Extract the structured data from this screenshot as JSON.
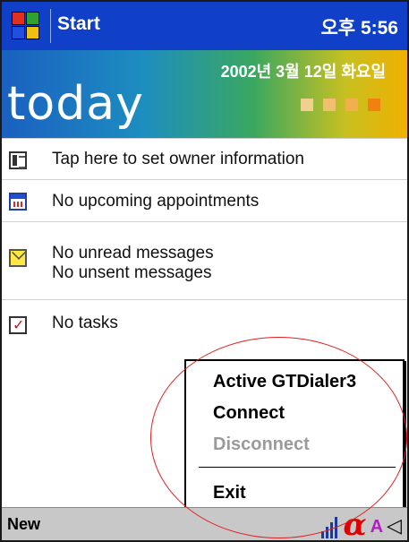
{
  "titlebar": {
    "start_label": "Start",
    "clock": "오후 5:56"
  },
  "banner": {
    "date": "2002년 3월 12일 화요일",
    "today": "today",
    "square_colors": [
      "#f0d090",
      "#f0c070",
      "#f0b050",
      "#f08010"
    ]
  },
  "today_items": {
    "owner": "Tap here to set owner information",
    "appointments": "No upcoming appointments",
    "unread": "No unread messages",
    "unsent": "No unsent messages",
    "tasks": "No tasks"
  },
  "context_menu": {
    "items": [
      "Active GTDialer3",
      "Connect",
      "Disconnect",
      "Exit"
    ],
    "disabled": [
      "Disconnect"
    ]
  },
  "bottombar": {
    "new_label": "New",
    "alpha": "α",
    "kb": "A",
    "speaker": "◁"
  },
  "colors": {
    "titlebar": "#1040c8",
    "annotation": "#e02020"
  }
}
